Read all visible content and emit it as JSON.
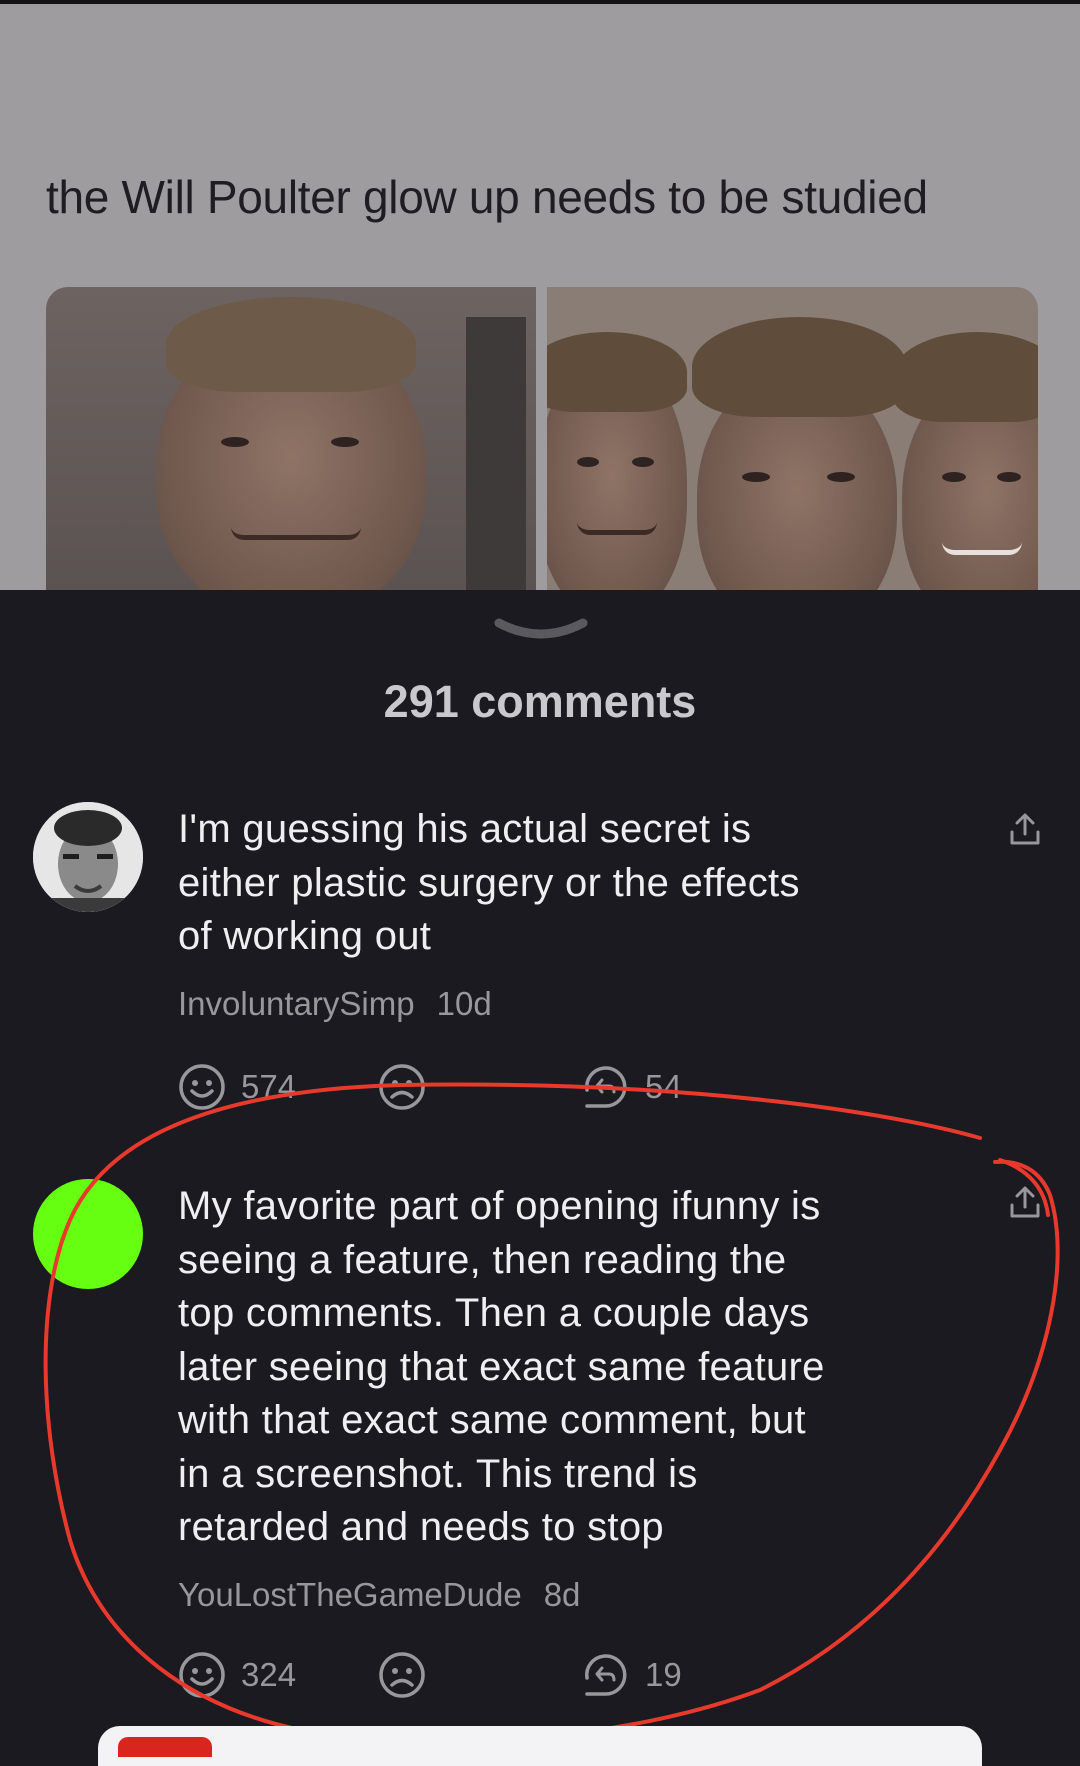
{
  "post": {
    "caption": "the Will Poulter glow up needs to be studied"
  },
  "comments_sheet": {
    "collapse_icon": "chevron-down-icon",
    "title": "291 comments"
  },
  "comments": [
    {
      "text": "I'm guessing his actual secret is\neither plastic surgery or the effects\nof working out",
      "author": "InvoluntarySimp",
      "time": "10d",
      "smiles": "574",
      "replies": "54",
      "avatar_color": "#d9d9d9"
    },
    {
      "text": "My favorite part of opening ifunny is\nseeing a feature, then reading the\ntop comments. Then a couple days\nlater seeing that exact same feature\nwith that exact same comment, but\nin a screenshot. This trend is\nretarded and needs to stop",
      "author": "YouLostTheGameDude",
      "time": "8d",
      "smiles": "324",
      "replies": "19",
      "avatar_color": "#66ff11"
    }
  ],
  "icons": {
    "smile": "smile-icon",
    "unsmile": "frown-icon",
    "reply": "reply-icon",
    "share": "share-icon"
  },
  "colors": {
    "background": "#1b1a20",
    "annotation": "#e8392c",
    "accent_red": "#d8261f"
  }
}
